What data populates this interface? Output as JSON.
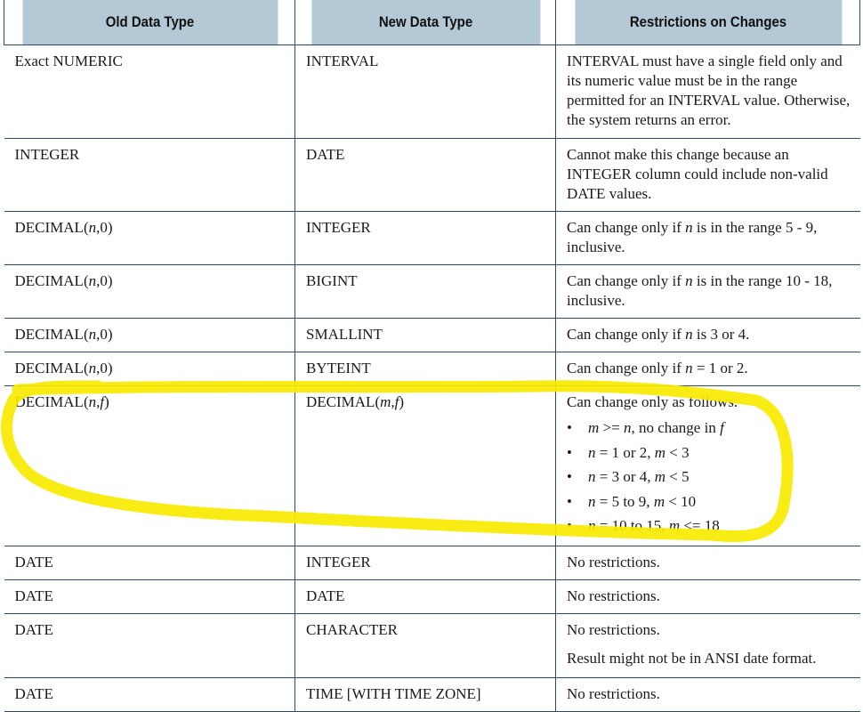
{
  "table": {
    "headers": [
      "Old Data Type",
      "New Data Type",
      "Restrictions on Changes"
    ],
    "rows": [
      {
        "old": "Exact NUMERIC",
        "new": "INTERVAL",
        "restriction": "INTERVAL must have a single field only and its numeric value must be in the range permitted for an INTERVAL value. Otherwise, the system returns an error."
      },
      {
        "old": "INTEGER",
        "new": "DATE",
        "restriction": "Cannot make this change because an INTEGER column could include non-valid DATE values."
      },
      {
        "old_prefix": "DECIMAL(",
        "old_var": "n",
        "old_suffix": ",0)",
        "new": "INTEGER",
        "r_prefix": "Can change only if ",
        "r_var": "n",
        "r_suffix": " is in the range 5 - 9, inclusive."
      },
      {
        "old_prefix": "DECIMAL(",
        "old_var": "n",
        "old_suffix": ",0)",
        "new": "BIGINT",
        "r_prefix": "Can change only if ",
        "r_var": "n",
        "r_suffix": " is in the range 10 - 18, inclusive."
      },
      {
        "old_prefix": "DECIMAL(",
        "old_var": "n",
        "old_suffix": ",0)",
        "new": "SMALLINT",
        "r_prefix": "Can change only if ",
        "r_var": "n",
        "r_suffix": " is 3 or 4."
      },
      {
        "old_prefix": "DECIMAL(",
        "old_var": "n",
        "old_suffix": ",0)",
        "new": "BYTEINT",
        "r_prefix": "Can change only if ",
        "r_var": "n",
        "r_suffix": " = 1 or 2."
      },
      {
        "old_prefix": "DECIMAL(",
        "old_var1": "n",
        "old_sep": ",",
        "old_var2": "f",
        "old_suffix": ")",
        "new_prefix": "DECIMAL(",
        "new_var1": "m",
        "new_sep": ",",
        "new_var2": "f",
        "new_suffix": ")",
        "restriction": "Can change only as follows.",
        "conditions": [
          {
            "v1": "m",
            "op1": " >= ",
            "v2": "n",
            "rest": ", no change in ",
            "v3": "f"
          },
          {
            "v1": "n",
            "mid": " = 1 or 2, ",
            "v2": "m",
            "tail": " < 3"
          },
          {
            "v1": "n",
            "mid": " = 3 or 4, ",
            "v2": "m",
            "tail": " < 5"
          },
          {
            "v1": "n",
            "mid": " = 5 to 9, ",
            "v2": "m",
            "tail": " < 10"
          },
          {
            "v1": "n",
            "mid": " = 10 to 15, ",
            "v2": "m",
            "tail": " <= 18"
          }
        ]
      },
      {
        "old": "DATE",
        "new": "INTEGER",
        "restriction": "No restrictions."
      },
      {
        "old": "DATE",
        "new": "DATE",
        "restriction": "No restrictions."
      },
      {
        "old": "DATE",
        "new": "CHARACTER",
        "restriction": "No restrictions.",
        "note": "Result might not be in ANSI date format."
      },
      {
        "old": "DATE",
        "new": "TIME [WITH TIME ZONE]",
        "restriction": "No restrictions."
      }
    ]
  },
  "highlight": {
    "color": "#f7ea00"
  }
}
